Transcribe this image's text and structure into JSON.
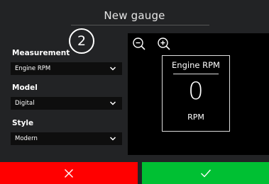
{
  "dialog": {
    "title": "New gauge",
    "step": "2"
  },
  "form": {
    "measurement": {
      "label": "Measurement",
      "value": "Engine RPM"
    },
    "model": {
      "label": "Model",
      "value": "Digital"
    },
    "style": {
      "label": "Style",
      "value": "Modern"
    }
  },
  "preview": {
    "gauge_title": "Engine RPM",
    "gauge_value": "0",
    "gauge_unit": "RPM"
  },
  "colors": {
    "cancel": "#ff0000",
    "confirm": "#00c033",
    "background": "#222325",
    "panel": "#000000"
  },
  "icons": {
    "zoom_out": "zoom-out-icon",
    "zoom_in": "zoom-in-icon",
    "cancel": "close-icon",
    "confirm": "check-icon"
  }
}
